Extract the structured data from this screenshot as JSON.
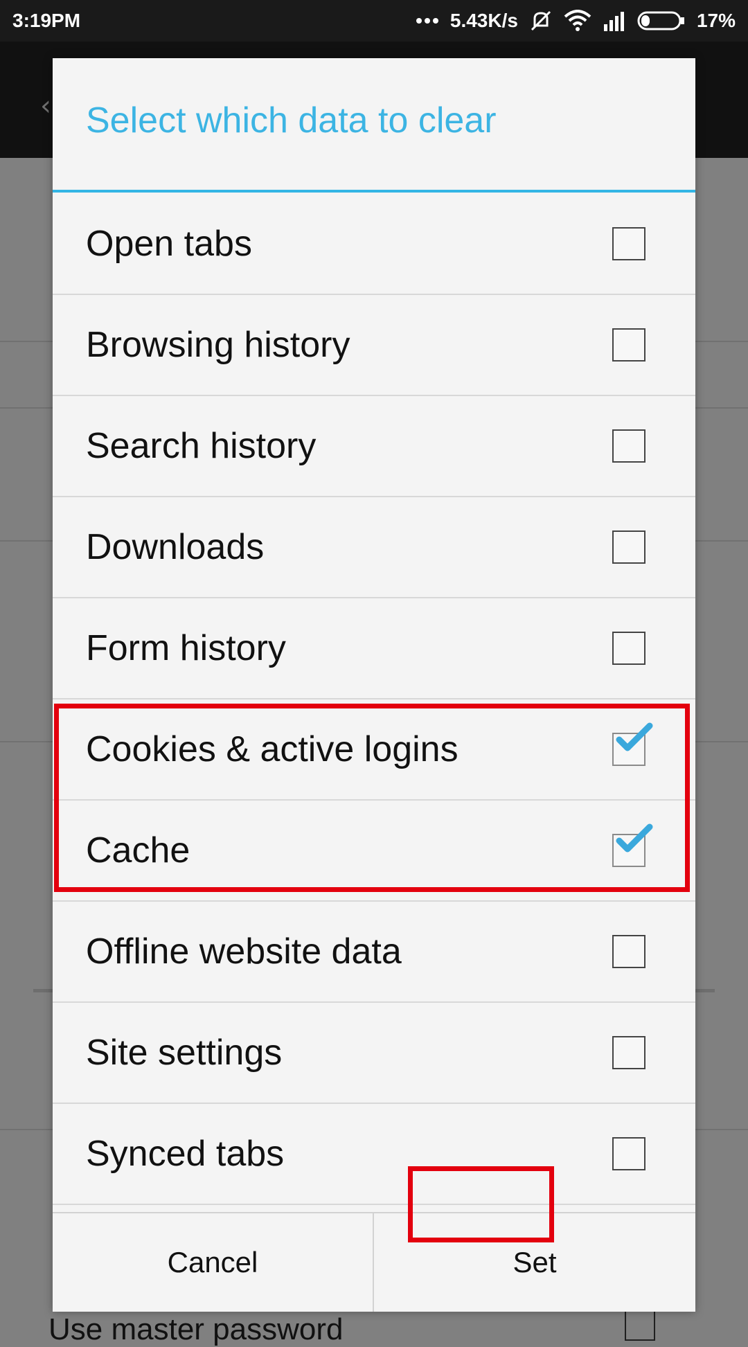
{
  "status_bar": {
    "time": "3:19PM",
    "network_speed": "5.43K/s",
    "battery": "17%",
    "icons": [
      "more-dots-icon",
      "mute-icon",
      "wifi-icon",
      "signal-icon",
      "battery-icon"
    ]
  },
  "background": {
    "visible_text": "Use master password"
  },
  "dialog": {
    "title": "Select which data to clear",
    "items": [
      {
        "label": "Open tabs",
        "checked": false
      },
      {
        "label": "Browsing history",
        "checked": false
      },
      {
        "label": "Search history",
        "checked": false
      },
      {
        "label": "Downloads",
        "checked": false
      },
      {
        "label": "Form history",
        "checked": false
      },
      {
        "label": "Cookies & active logins",
        "checked": true
      },
      {
        "label": "Cache",
        "checked": true
      },
      {
        "label": "Offline website data",
        "checked": false
      },
      {
        "label": "Site settings",
        "checked": false
      },
      {
        "label": "Synced tabs",
        "checked": false
      }
    ],
    "cancel_label": "Cancel",
    "set_label": "Set"
  },
  "colors": {
    "accent": "#33b5e5",
    "highlight": "#e3000e",
    "check": "#3aa8dc"
  }
}
